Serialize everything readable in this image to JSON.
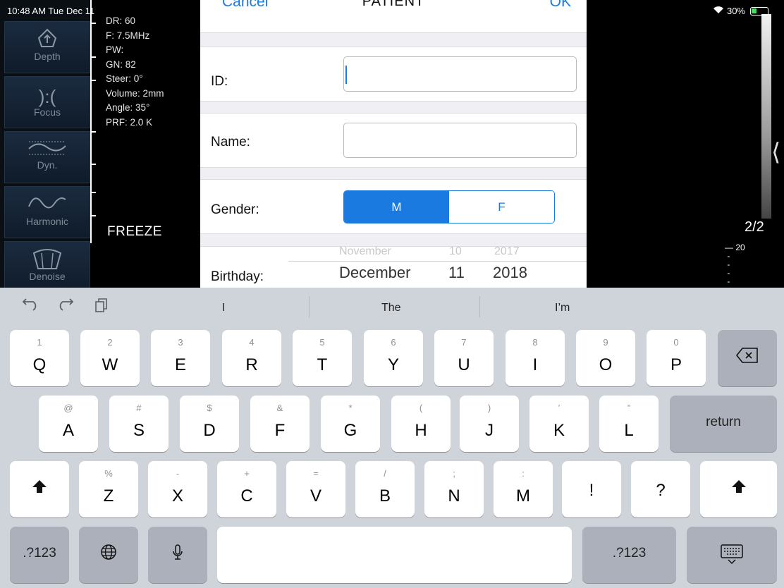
{
  "status": {
    "time_date": "10:48 AM  Tue Dec 11",
    "battery": "30%"
  },
  "sidebar": {
    "items": [
      {
        "label": "Depth"
      },
      {
        "label": "Focus"
      },
      {
        "label": "Dyn."
      },
      {
        "label": "Harmonic"
      },
      {
        "label": "Denoise"
      }
    ]
  },
  "params": [
    "DR: 60",
    "F: 7.5MHz",
    "PW:",
    "GN: 82",
    "Steer: 0°",
    "Volume: 2mm",
    "Angle: 35°",
    "PRF: 2.0 K"
  ],
  "freeze_label": "FREEZE",
  "right_panel": {
    "page": "2/2",
    "scale_top": "20"
  },
  "modal": {
    "cancel": "Cancel",
    "title": "PATIENT",
    "ok": "OK",
    "id_label": "ID:",
    "name_label": "Name:",
    "gender_label": "Gender:",
    "gender_m": "M",
    "gender_f": "F",
    "birthday_label": "Birthday:",
    "birthday": {
      "month": "December",
      "day": "11",
      "year": "2018",
      "prev_month": "November",
      "prev_day": "10",
      "prev_year": "2017"
    }
  },
  "keyboard": {
    "suggestions": [
      "I",
      "The",
      "I’m"
    ],
    "row1": [
      {
        "hint": "1",
        "key": "Q"
      },
      {
        "hint": "2",
        "key": "W"
      },
      {
        "hint": "3",
        "key": "E"
      },
      {
        "hint": "4",
        "key": "R"
      },
      {
        "hint": "5",
        "key": "T"
      },
      {
        "hint": "6",
        "key": "Y"
      },
      {
        "hint": "7",
        "key": "U"
      },
      {
        "hint": "8",
        "key": "I"
      },
      {
        "hint": "9",
        "key": "O"
      },
      {
        "hint": "0",
        "key": "P"
      }
    ],
    "row2": [
      {
        "hint": "@",
        "key": "A"
      },
      {
        "hint": "#",
        "key": "S"
      },
      {
        "hint": "$",
        "key": "D"
      },
      {
        "hint": "&",
        "key": "F"
      },
      {
        "hint": "*",
        "key": "G"
      },
      {
        "hint": "(",
        "key": "H"
      },
      {
        "hint": ")",
        "key": "J"
      },
      {
        "hint": "’",
        "key": "K"
      },
      {
        "hint": "”",
        "key": "L"
      }
    ],
    "row3": [
      {
        "hint": "%",
        "key": "Z"
      },
      {
        "hint": "-",
        "key": "X"
      },
      {
        "hint": "+",
        "key": "C"
      },
      {
        "hint": "=",
        "key": "V"
      },
      {
        "hint": "/",
        "key": "B"
      },
      {
        "hint": ";",
        "key": "N"
      },
      {
        "hint": ":",
        "key": "M"
      },
      {
        "hint": "",
        "key": "!"
      },
      {
        "hint": "",
        "key": "?"
      }
    ],
    "return_label": "return",
    "numbers_label": ".?123",
    "icons": {
      "undo": "undo-icon",
      "redo": "redo-icon",
      "paste": "paste-icon",
      "delete": "backspace-icon",
      "shift": "shift-icon",
      "globe": "globe-icon",
      "mic": "microphone-icon",
      "hide": "keyboard-hide-icon"
    }
  }
}
